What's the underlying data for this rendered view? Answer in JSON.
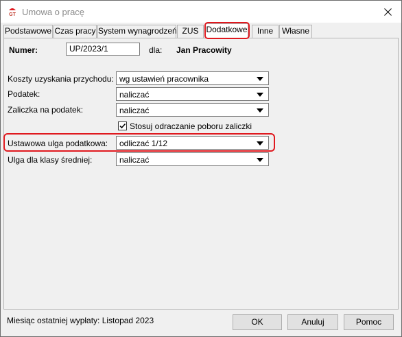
{
  "window": {
    "title": "Umowa o pracę",
    "app_icon": "app-logo-icon",
    "close_icon": "close-icon"
  },
  "tabs": [
    {
      "label": "Podstawowe"
    },
    {
      "label": "Czas pracy"
    },
    {
      "label": "System wynagrodzeń"
    },
    {
      "label": "ZUS"
    },
    {
      "label": "Dodatkowe",
      "active": true
    },
    {
      "label": "Inne"
    },
    {
      "label": "Własne"
    }
  ],
  "header": {
    "number_label": "Numer:",
    "number_value": "UP/2023/1",
    "for_label": "dla:",
    "employee_name": "Jan Pracowity"
  },
  "fields": {
    "koszty": {
      "label": "Koszty uzyskania przychodu:",
      "value": "wg ustawień pracownika"
    },
    "podatek": {
      "label": "Podatek:",
      "value": "naliczać"
    },
    "zaliczka": {
      "label": "Zaliczka na podatek:",
      "value": "naliczać"
    },
    "odraczanie": {
      "label": "Stosuj odraczanie poboru zaliczki",
      "checked": true
    },
    "ulga": {
      "label": "Ustawowa ulga podatkowa:",
      "value": "odliczać 1/12"
    },
    "ulga_srednia": {
      "label": "Ulga dla klasy średniej:",
      "value": "naliczać"
    }
  },
  "footer": {
    "status": "Miesiąc ostatniej wypłaty: Listopad 2023",
    "ok_label": "OK",
    "cancel_label": "Anuluj",
    "help_label": "Pomoc"
  },
  "colors": {
    "highlight": "#e0191f",
    "window_bg": "#f0f0f0"
  }
}
